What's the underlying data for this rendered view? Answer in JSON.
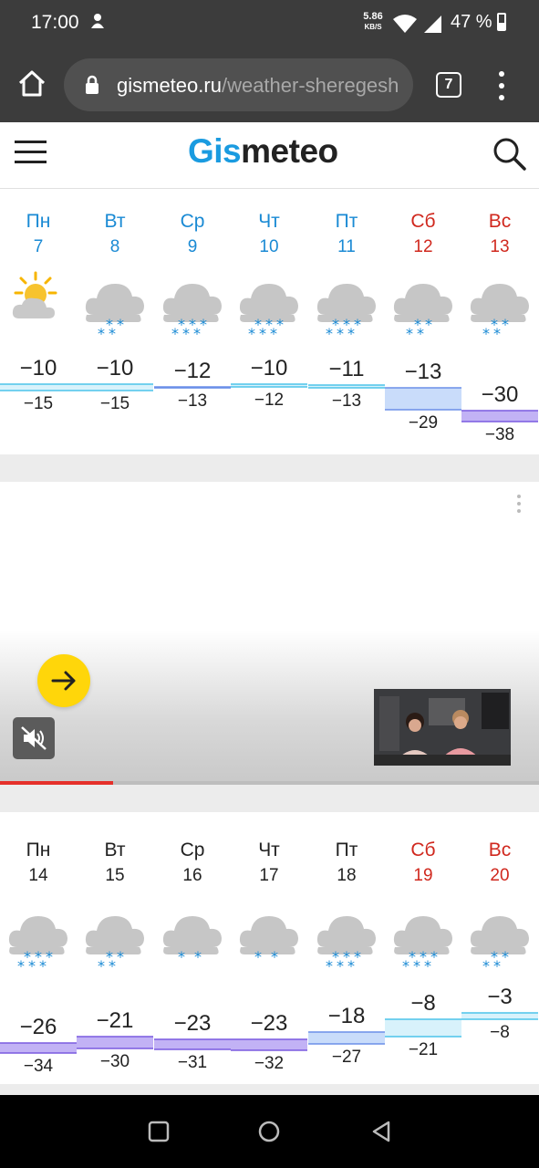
{
  "status": {
    "time": "17:00",
    "speed_value": "5.86",
    "speed_unit": "KB/S",
    "battery": "47 %"
  },
  "browser": {
    "url_host": "gismeteo.ru",
    "url_path": "/weather-sheregesh",
    "tab_count": "7"
  },
  "site": {
    "logo_part1": "Gis",
    "logo_part2": "meteo"
  },
  "week1": [
    {
      "name": "Пн",
      "date": "7",
      "weekend": false,
      "icon": "sun-cloud-icon",
      "snow": 0,
      "max": "−10",
      "min": "−15",
      "max_v": -10,
      "min_v": -15
    },
    {
      "name": "Вт",
      "date": "8",
      "weekend": false,
      "icon": "cloud-snow-icon",
      "snow": 2,
      "max": "−10",
      "min": "−15",
      "max_v": -10,
      "min_v": -15
    },
    {
      "name": "Ср",
      "date": "9",
      "weekend": false,
      "icon": "cloud-snow-icon",
      "snow": 3,
      "max": "−12",
      "min": "−13",
      "max_v": -12,
      "min_v": -13
    },
    {
      "name": "Чт",
      "date": "10",
      "weekend": false,
      "icon": "cloud-snow-icon",
      "snow": 3,
      "max": "−10",
      "min": "−12",
      "max_v": -10,
      "min_v": -12
    },
    {
      "name": "Пт",
      "date": "11",
      "weekend": false,
      "icon": "cloud-snow-icon",
      "snow": 3,
      "max": "−11",
      "min": "−13",
      "max_v": -11,
      "min_v": -13
    },
    {
      "name": "Сб",
      "date": "12",
      "weekend": true,
      "icon": "cloud-snow-icon",
      "snow": 2,
      "max": "−13",
      "min": "−29",
      "max_v": -13,
      "min_v": -29
    },
    {
      "name": "Вс",
      "date": "13",
      "weekend": true,
      "icon": "cloud-snow-icon",
      "snow": 2,
      "max": "−30",
      "min": "−38",
      "max_v": -30,
      "min_v": -38
    }
  ],
  "week2": [
    {
      "name": "Пн",
      "date": "14",
      "weekend": false,
      "icon": "cloud-snow-icon",
      "snow": 3,
      "max": "−26",
      "min": "−34",
      "max_v": -26,
      "min_v": -34
    },
    {
      "name": "Вт",
      "date": "15",
      "weekend": false,
      "icon": "cloud-snow-icon",
      "snow": 2,
      "max": "−21",
      "min": "−30",
      "max_v": -21,
      "min_v": -30
    },
    {
      "name": "Ср",
      "date": "16",
      "weekend": false,
      "icon": "cloud-snow-icon",
      "snow": 1,
      "max": "−23",
      "min": "−31",
      "max_v": -23,
      "min_v": -31
    },
    {
      "name": "Чт",
      "date": "17",
      "weekend": false,
      "icon": "cloud-snow-icon",
      "snow": 1,
      "max": "−23",
      "min": "−32",
      "max_v": -23,
      "min_v": -32
    },
    {
      "name": "Пт",
      "date": "18",
      "weekend": false,
      "icon": "cloud-snow-icon",
      "snow": 3,
      "max": "−18",
      "min": "−27",
      "max_v": -18,
      "min_v": -27
    },
    {
      "name": "Сб",
      "date": "19",
      "weekend": true,
      "icon": "cloud-snow-icon",
      "snow": 3,
      "max": "−8",
      "min": "−21",
      "max_v": -8,
      "min_v": -21
    },
    {
      "name": "Вс",
      "date": "20",
      "weekend": true,
      "icon": "cloud-snow-icon",
      "snow": 2,
      "max": "−3",
      "min": "−8",
      "max_v": -3,
      "min_v": -8
    }
  ],
  "ad": {
    "progress": 0.21
  },
  "colors": {
    "weekday_blue": "#1a8ad4",
    "weekend_red": "#d0281e",
    "week2_dark": "#222222",
    "cold_purple": "#b19cf2",
    "mild_blue": "#c9dcfa",
    "light_cyan": "#d8f2fb"
  }
}
